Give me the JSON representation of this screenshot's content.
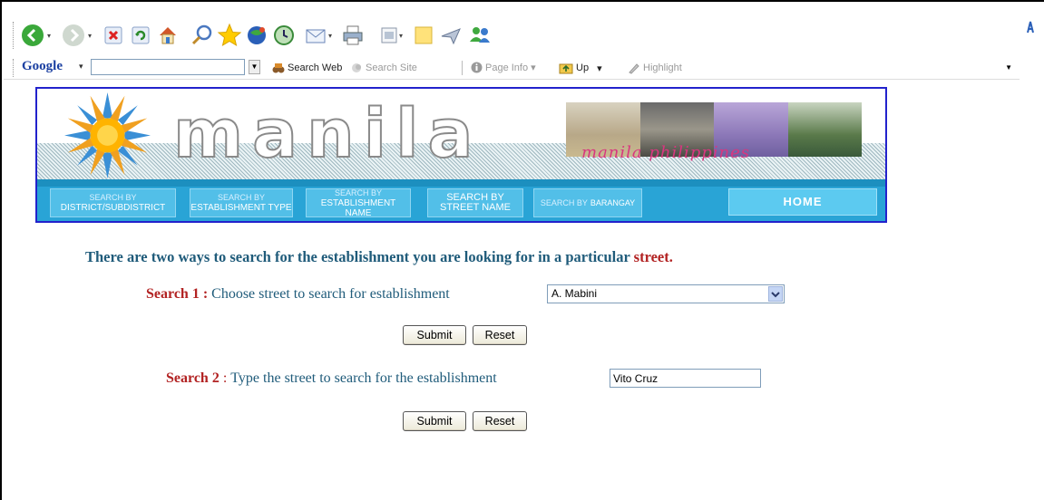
{
  "browser": {
    "google_bar": {
      "logo": "Google",
      "search_value": "",
      "items": [
        {
          "label": "Search Web",
          "dim": false
        },
        {
          "label": "Search Site",
          "dim": true
        },
        {
          "label": "Page Info",
          "dim": true
        },
        {
          "label": "Up",
          "dim": false
        },
        {
          "label": "Highlight",
          "dim": true
        }
      ]
    }
  },
  "banner": {
    "wordmark": "manila",
    "photo_caption": "manila philippines",
    "nav": [
      {
        "line1": "SEARCH BY",
        "line2": "DISTRICT/SUBDISTRICT"
      },
      {
        "line1": "SEARCH BY",
        "line2": "ESTABLISHMENT TYPE"
      },
      {
        "line1": "SEARCH BY",
        "line2": "ESTABLISHMENT NAME"
      },
      {
        "line1": "SEARCH  BY",
        "line2": "STREET NAME"
      },
      {
        "line1": "SEARCH BY",
        "line2": "BARANGAY"
      }
    ],
    "home": "HOME"
  },
  "content": {
    "intro_main": "There are two ways to search for the establishment you are looking for in a particular ",
    "intro_highlight": "street.",
    "search1": {
      "label": "Search 1",
      "separator": ":",
      "text": "Choose street to search for establishment",
      "selected": "A. Mabini",
      "submit": "Submit",
      "reset": "Reset"
    },
    "search2": {
      "label": "Search 2",
      "separator": ":",
      "text": "Type the street to search for the establishment",
      "value": "Vito Cruz",
      "submit": "Submit",
      "reset": "Reset"
    }
  },
  "colors": {
    "accent_red": "#b22222",
    "text_teal": "#1f5b7a",
    "nav_blue": "#29a4d6",
    "banner_border": "#2222cc"
  }
}
